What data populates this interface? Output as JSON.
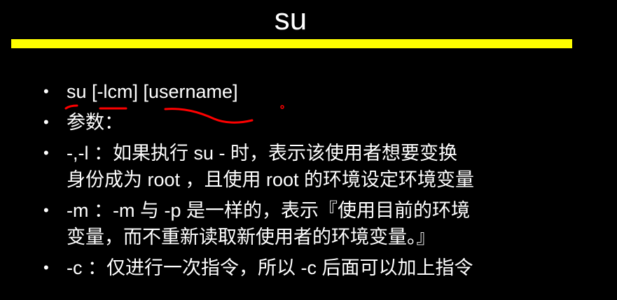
{
  "slide": {
    "title": "su",
    "accent_color": "#ffff00",
    "annotation_color": "#ff0000",
    "bullet_symbol": "•",
    "bullets": [
      {
        "text": "su [-lcm] [username]"
      },
      {
        "text": "参数："
      },
      {
        "text": "-,-l ：如果执行 su - 时，表示该使用者想要变换\n身份成为 root ，且使用 root 的环境设定环境变量"
      },
      {
        "text": "-m ：-m 与 -p 是一样的，表示『使用目前的环境\n变量，而不重新读取新使用者的环境变量。』"
      },
      {
        "text": "-c ：仅进行一次指令，所以 -c 后面可以加上指令"
      }
    ]
  }
}
